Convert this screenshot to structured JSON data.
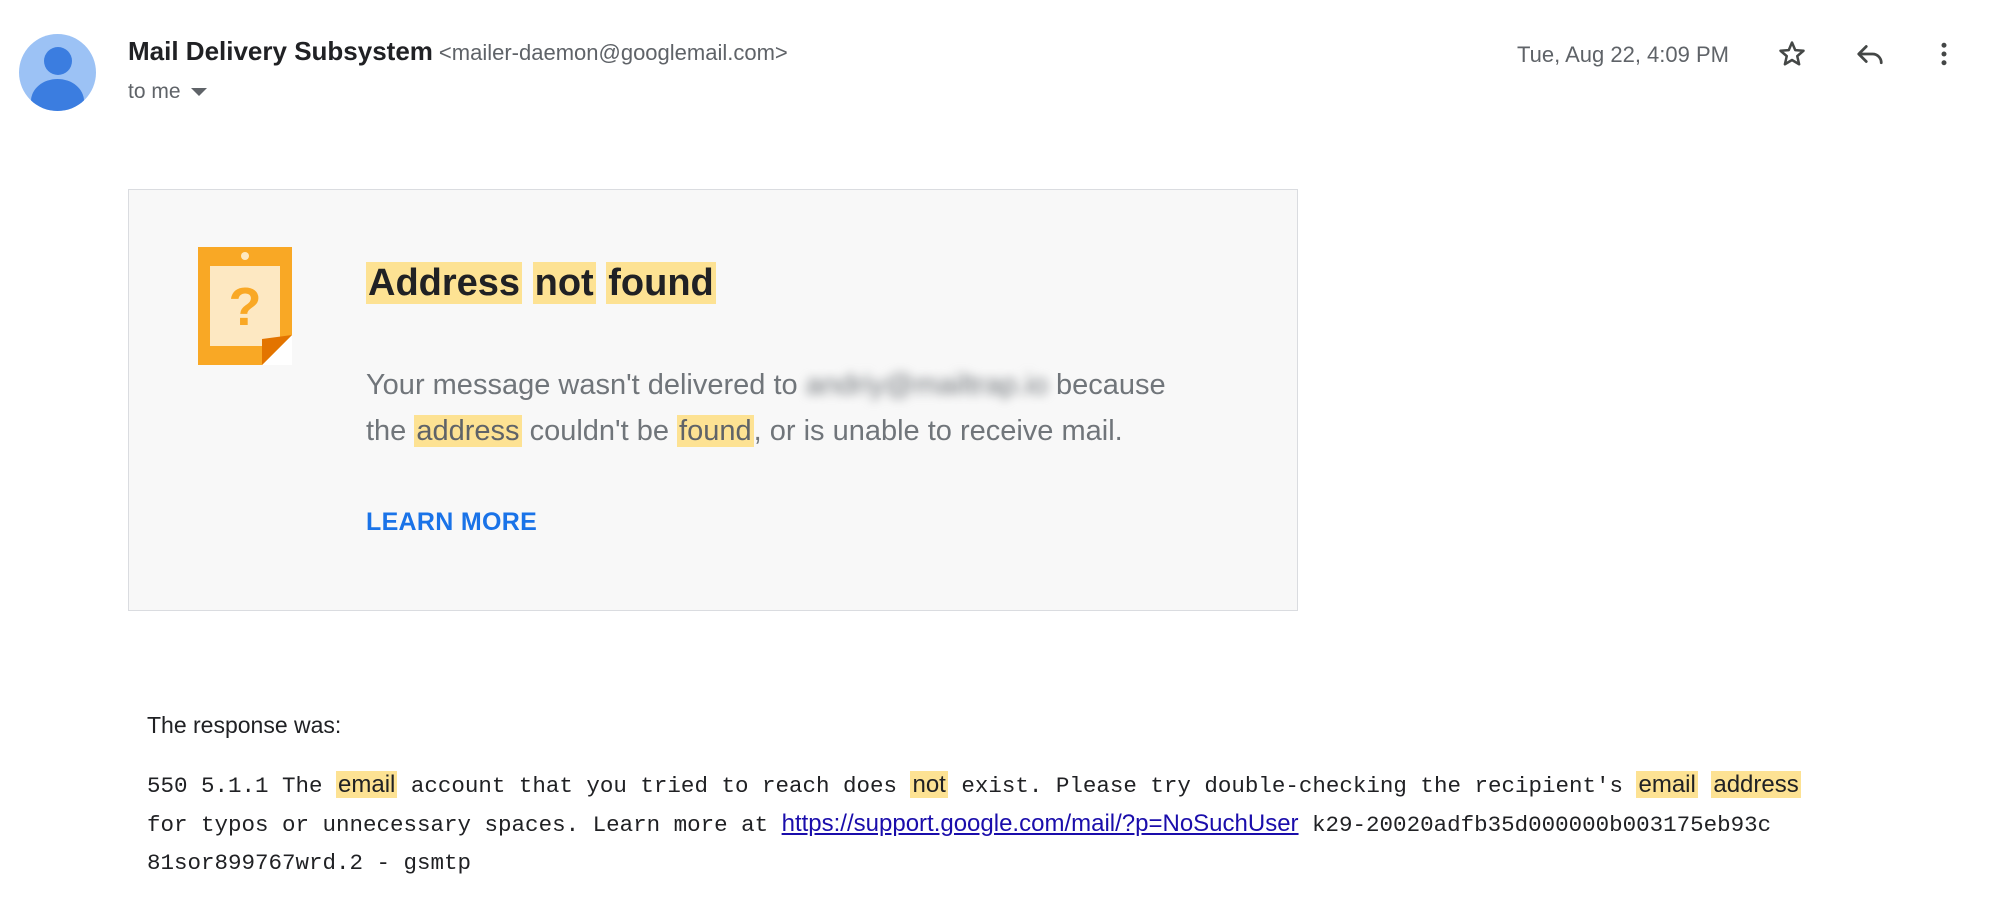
{
  "header": {
    "sender_name": "Mail Delivery Subsystem",
    "sender_email": "<mailer-daemon@googlemail.com>",
    "to_label": "to me",
    "date": "Tue, Aug 22, 4:09 PM",
    "icons": [
      "avatar",
      "star-icon",
      "reply-icon",
      "more-vert-icon",
      "chevron-down-icon"
    ]
  },
  "card": {
    "title_words": [
      "Address",
      "not",
      "found"
    ],
    "body": {
      "p1": "Your message wasn't delivered to ",
      "recipient_blurred": "andriy@mailtrap.io",
      "p2": " because",
      "p3": "the ",
      "hl_address": "address",
      "p4": " couldn't be ",
      "hl_found": "found",
      "p5": ", or is unable to receive mail."
    },
    "learn_more": "LEARN MORE",
    "icon": "question-note-icon"
  },
  "response": {
    "label": "The response was:",
    "t1": "550 5.1.1 The ",
    "hl_email1": "email",
    "t2": " account that you tried to reach does ",
    "hl_not": "not",
    "t3": " exist. Please try double-checking the recipient's ",
    "hl_email2": "email",
    "t4": " ",
    "hl_address": "address",
    "t5": "\nfor typos or unnecessary spaces. Learn more at ",
    "link": "https://support.google.com/mail/?p=NoSuchUser",
    "t6": " k29-20020adfb35d000000b003175eb93c\n81sor899767wrd.2 - gsmtp"
  },
  "colors": {
    "highlight": "#fde293",
    "link_blue": "#1a73e8",
    "note_orange": "#f9a825"
  }
}
